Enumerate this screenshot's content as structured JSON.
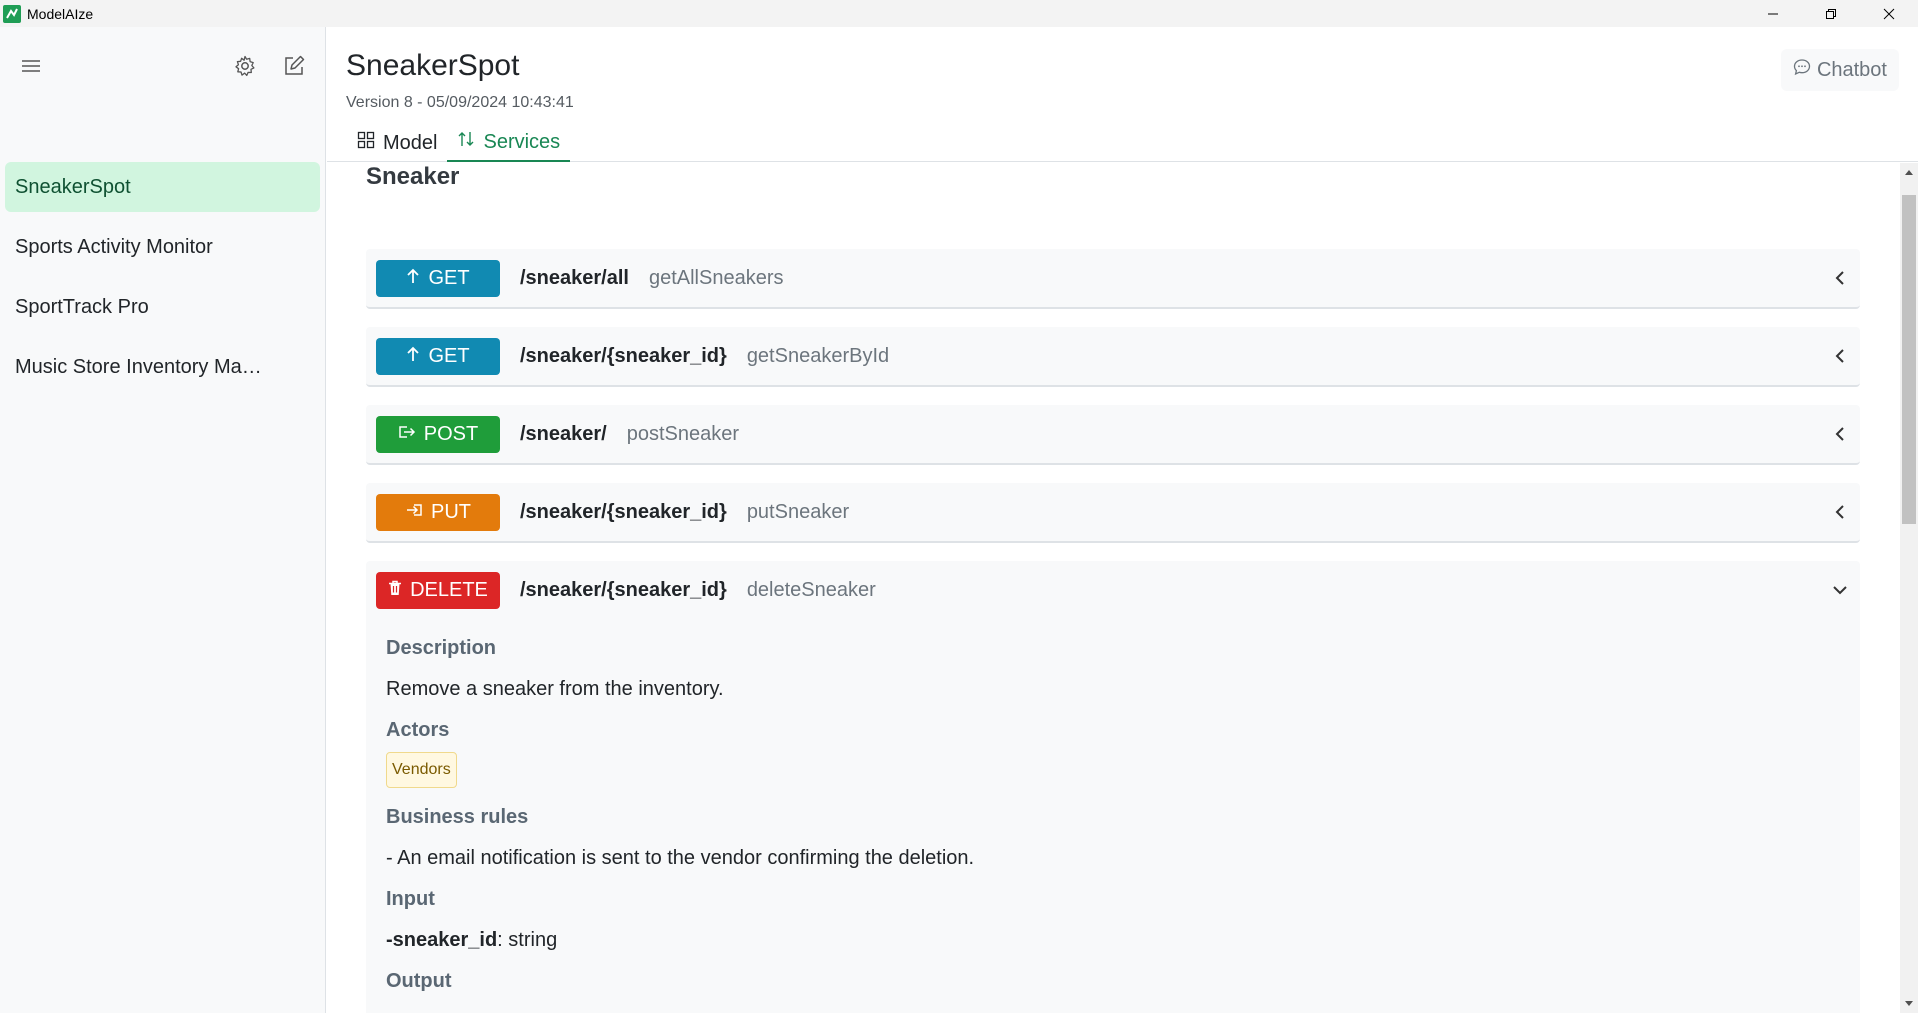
{
  "app": {
    "title": "ModelAIze"
  },
  "sidebar": {
    "projects": [
      {
        "label": "SneakerSpot",
        "active": true
      },
      {
        "label": "Sports Activity Monitor",
        "active": false
      },
      {
        "label": "SportTrack Pro",
        "active": false
      },
      {
        "label": "Music Store Inventory Ma…",
        "active": false
      }
    ]
  },
  "header": {
    "title": "SneakerSpot",
    "version": "Version 8 - 05/09/2024 10:43:41",
    "chatbot_label": "Chatbot",
    "tabs": [
      {
        "label": "Model",
        "icon": "grid-icon",
        "active": false
      },
      {
        "label": "Services",
        "icon": "arrows-up-down-icon",
        "active": true
      }
    ]
  },
  "section": {
    "title": "Sneaker"
  },
  "services": [
    {
      "method": "GET",
      "path": "/sneaker/all",
      "name": "getAllSneakers",
      "color": "#118ab2"
    },
    {
      "method": "GET",
      "path": "/sneaker/{sneaker_id}",
      "name": "getSneakerById",
      "color": "#118ab2"
    },
    {
      "method": "POST",
      "path": "/sneaker/",
      "name": "postSneaker",
      "color": "#1f9d3a"
    },
    {
      "method": "PUT",
      "path": "/sneaker/{sneaker_id}",
      "name": "putSneaker",
      "color": "#e37b0c"
    },
    {
      "method": "DELETE",
      "path": "/sneaker/{sneaker_id}",
      "name": "deleteSneaker",
      "color": "#dc2626"
    }
  ],
  "details": {
    "description_label": "Description",
    "description": "Remove a sneaker from the inventory.",
    "actors_label": "Actors",
    "actor": "Vendors",
    "rules_label": "Business rules",
    "rule": "- An email notification is sent to the vendor confirming the deletion.",
    "input_label": "Input",
    "input_param": "-sneaker_id",
    "input_type": ": string",
    "output_label": "Output"
  }
}
